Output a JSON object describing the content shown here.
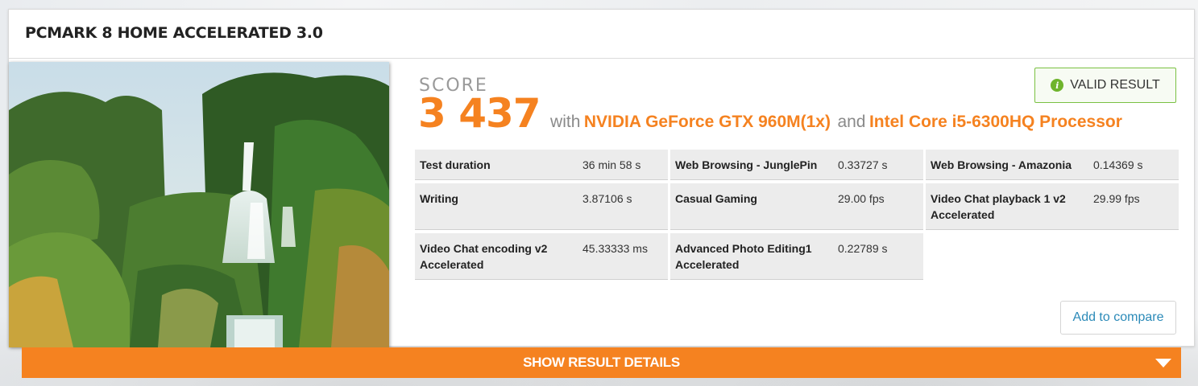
{
  "card": {
    "title": "PCMARK 8 HOME ACCELERATED 3.0"
  },
  "score": {
    "label": "SCORE",
    "value": "3 437",
    "with_text": "with",
    "gpu": "NVIDIA GeForce GTX 960M(1x)",
    "and_text": "and",
    "cpu": "Intel Core i5-6300HQ Processor"
  },
  "valid_result": {
    "label": "VALID RESULT",
    "icon": "info-icon"
  },
  "results": [
    {
      "name": "Test duration",
      "value": "36 min 58 s"
    },
    {
      "name": "Web Browsing - JunglePin",
      "value": "0.33727 s"
    },
    {
      "name": "Web Browsing - Amazonia",
      "value": "0.14369 s"
    },
    {
      "name": "Writing",
      "value": "3.87106 s"
    },
    {
      "name": "Casual Gaming",
      "value": "29.00 fps"
    },
    {
      "name": "Video Chat playback 1 v2 Accelerated",
      "value": "29.99 fps"
    },
    {
      "name": "Video Chat encoding v2 Accelerated",
      "value": "45.33333 ms"
    },
    {
      "name": "Advanced Photo Editing1 Accelerated",
      "value": "0.22789 s"
    }
  ],
  "add_to_compare": "Add to compare",
  "show_details": {
    "label": "SHOW RESULT DETAILS",
    "icon": "chevron-down-icon"
  },
  "colors": {
    "accent": "#f58220",
    "valid_border": "#7ac142",
    "link": "#2b8ab8"
  }
}
